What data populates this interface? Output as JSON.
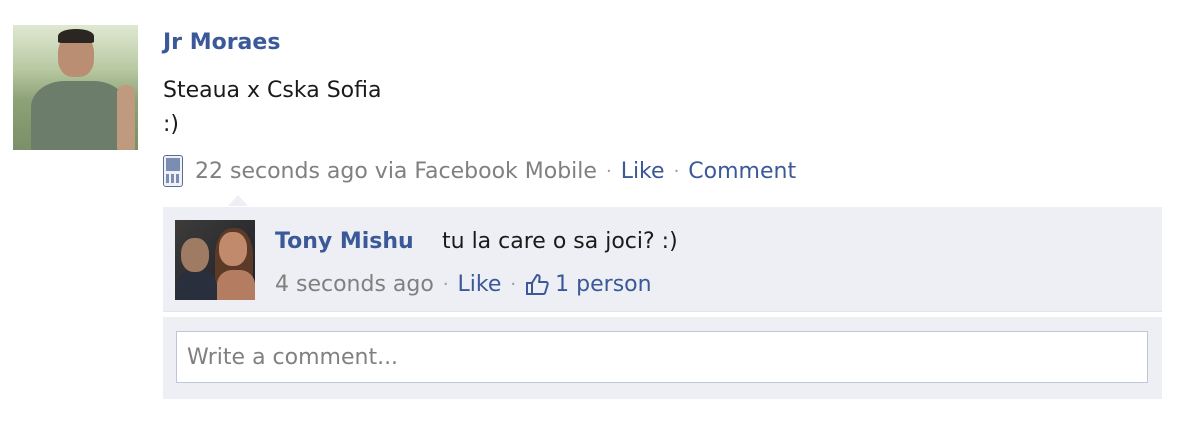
{
  "post": {
    "author": "Jr Moraes",
    "text_line1": "Steaua x Cska Sofia",
    "text_line2": ":)",
    "timestamp": "22 seconds ago via Facebook Mobile",
    "like_label": "Like",
    "comment_label": "Comment",
    "separator": "·",
    "icons": {
      "mobile": "mobile-phone-icon"
    }
  },
  "comment": {
    "author": "Tony Mishu",
    "text": "tu la care o sa joci? :)",
    "timestamp": "4 seconds ago",
    "like_label": "Like",
    "likes_count": "1 person",
    "icons": {
      "thumb": "thumbs-up-icon"
    }
  },
  "write_comment": {
    "placeholder": "Write a comment..."
  },
  "colors": {
    "link": "#3b5998",
    "meta_text": "#808080",
    "comment_bg": "#edeff4"
  }
}
